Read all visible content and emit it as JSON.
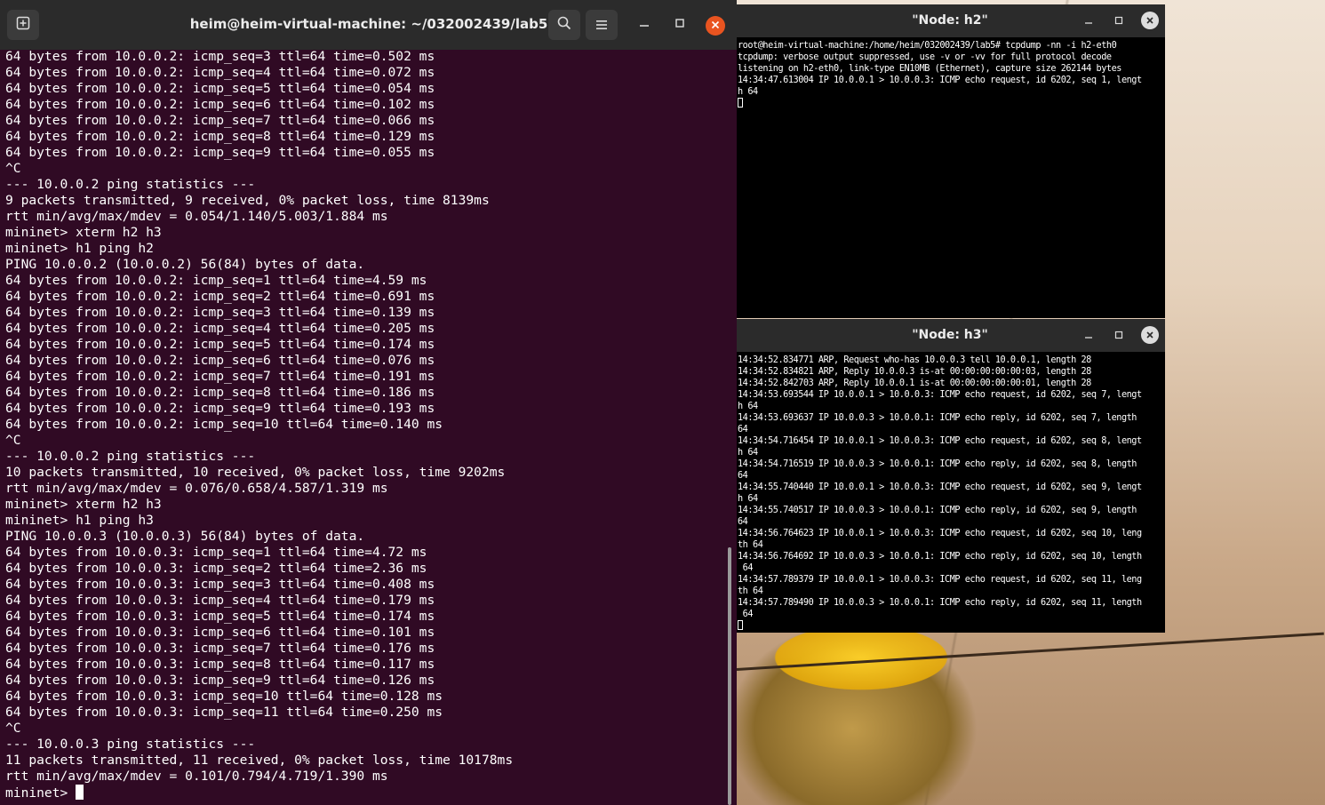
{
  "main_terminal": {
    "title": "heim@heim-virtual-machine: ~/032002439/lab5",
    "lines": [
      "64 bytes from 10.0.0.2: icmp_seq=3 ttl=64 time=0.502 ms",
      "64 bytes from 10.0.0.2: icmp_seq=4 ttl=64 time=0.072 ms",
      "64 bytes from 10.0.0.2: icmp_seq=5 ttl=64 time=0.054 ms",
      "64 bytes from 10.0.0.2: icmp_seq=6 ttl=64 time=0.102 ms",
      "64 bytes from 10.0.0.2: icmp_seq=7 ttl=64 time=0.066 ms",
      "64 bytes from 10.0.0.2: icmp_seq=8 ttl=64 time=0.129 ms",
      "64 bytes from 10.0.0.2: icmp_seq=9 ttl=64 time=0.055 ms",
      "^C",
      "--- 10.0.0.2 ping statistics ---",
      "9 packets transmitted, 9 received, 0% packet loss, time 8139ms",
      "rtt min/avg/max/mdev = 0.054/1.140/5.003/1.884 ms",
      "mininet> xterm h2 h3",
      "mininet> h1 ping h2",
      "PING 10.0.0.2 (10.0.0.2) 56(84) bytes of data.",
      "64 bytes from 10.0.0.2: icmp_seq=1 ttl=64 time=4.59 ms",
      "64 bytes from 10.0.0.2: icmp_seq=2 ttl=64 time=0.691 ms",
      "64 bytes from 10.0.0.2: icmp_seq=3 ttl=64 time=0.139 ms",
      "64 bytes from 10.0.0.2: icmp_seq=4 ttl=64 time=0.205 ms",
      "64 bytes from 10.0.0.2: icmp_seq=5 ttl=64 time=0.174 ms",
      "64 bytes from 10.0.0.2: icmp_seq=6 ttl=64 time=0.076 ms",
      "64 bytes from 10.0.0.2: icmp_seq=7 ttl=64 time=0.191 ms",
      "64 bytes from 10.0.0.2: icmp_seq=8 ttl=64 time=0.186 ms",
      "64 bytes from 10.0.0.2: icmp_seq=9 ttl=64 time=0.193 ms",
      "64 bytes from 10.0.0.2: icmp_seq=10 ttl=64 time=0.140 ms",
      "^C",
      "--- 10.0.0.2 ping statistics ---",
      "10 packets transmitted, 10 received, 0% packet loss, time 9202ms",
      "rtt min/avg/max/mdev = 0.076/0.658/4.587/1.319 ms",
      "mininet> xterm h2 h3",
      "mininet> h1 ping h3",
      "PING 10.0.0.3 (10.0.0.3) 56(84) bytes of data.",
      "64 bytes from 10.0.0.3: icmp_seq=1 ttl=64 time=4.72 ms",
      "64 bytes from 10.0.0.3: icmp_seq=2 ttl=64 time=2.36 ms",
      "64 bytes from 10.0.0.3: icmp_seq=3 ttl=64 time=0.408 ms",
      "64 bytes from 10.0.0.3: icmp_seq=4 ttl=64 time=0.179 ms",
      "64 bytes from 10.0.0.3: icmp_seq=5 ttl=64 time=0.174 ms",
      "64 bytes from 10.0.0.3: icmp_seq=6 ttl=64 time=0.101 ms",
      "64 bytes from 10.0.0.3: icmp_seq=7 ttl=64 time=0.176 ms",
      "64 bytes from 10.0.0.3: icmp_seq=8 ttl=64 time=0.117 ms",
      "64 bytes from 10.0.0.3: icmp_seq=9 ttl=64 time=0.126 ms",
      "64 bytes from 10.0.0.3: icmp_seq=10 ttl=64 time=0.128 ms",
      "64 bytes from 10.0.0.3: icmp_seq=11 ttl=64 time=0.250 ms",
      "^C",
      "--- 10.0.0.3 ping statistics ---",
      "11 packets transmitted, 11 received, 0% packet loss, time 10178ms",
      "rtt min/avg/max/mdev = 0.101/0.794/4.719/1.390 ms"
    ],
    "prompt": "mininet> ",
    "icons": {
      "new_tab": "new-tab-icon",
      "search": "search-icon",
      "menu": "hamburger-menu-icon",
      "minimize": "minimize-icon",
      "maximize": "maximize-icon",
      "close": "close-icon"
    },
    "colors": {
      "background": "#300a24",
      "titlebar": "#2b2b2b",
      "close_button": "#e95420"
    }
  },
  "xterm_h2": {
    "title": "\"Node: h2\"",
    "lines": [
      "root@heim-virtual-machine:/home/heim/032002439/lab5# tcpdump -nn -i h2-eth0",
      "tcpdump: verbose output suppressed, use -v or -vv for full protocol decode",
      "listening on h2-eth0, link-type EN10MB (Ethernet), capture size 262144 bytes",
      "14:34:47.613004 IP 10.0.0.1 > 10.0.0.3: ICMP echo request, id 6202, seq 1, lengt",
      "h 64"
    ]
  },
  "xterm_h3": {
    "title": "\"Node: h3\"",
    "lines": [
      "14:34:52.834771 ARP, Request who-has 10.0.0.3 tell 10.0.0.1, length 28",
      "14:34:52.834821 ARP, Reply 10.0.0.3 is-at 00:00:00:00:00:03, length 28",
      "14:34:52.842703 ARP, Reply 10.0.0.1 is-at 00:00:00:00:00:01, length 28",
      "14:34:53.693544 IP 10.0.0.1 > 10.0.0.3: ICMP echo request, id 6202, seq 7, lengt",
      "h 64",
      "14:34:53.693637 IP 10.0.0.3 > 10.0.0.1: ICMP echo reply, id 6202, seq 7, length",
      "64",
      "14:34:54.716454 IP 10.0.0.1 > 10.0.0.3: ICMP echo request, id 6202, seq 8, lengt",
      "h 64",
      "14:34:54.716519 IP 10.0.0.3 > 10.0.0.1: ICMP echo reply, id 6202, seq 8, length",
      "64",
      "14:34:55.740440 IP 10.0.0.1 > 10.0.0.3: ICMP echo request, id 6202, seq 9, lengt",
      "h 64",
      "14:34:55.740517 IP 10.0.0.3 > 10.0.0.1: ICMP echo reply, id 6202, seq 9, length",
      "64",
      "14:34:56.764623 IP 10.0.0.1 > 10.0.0.3: ICMP echo request, id 6202, seq 10, leng",
      "th 64",
      "14:34:56.764692 IP 10.0.0.3 > 10.0.0.1: ICMP echo reply, id 6202, seq 10, length",
      " 64",
      "14:34:57.789379 IP 10.0.0.1 > 10.0.0.3: ICMP echo request, id 6202, seq 11, leng",
      "th 64",
      "14:34:57.789490 IP 10.0.0.3 > 10.0.0.1: ICMP echo reply, id 6202, seq 11, length",
      " 64"
    ]
  }
}
